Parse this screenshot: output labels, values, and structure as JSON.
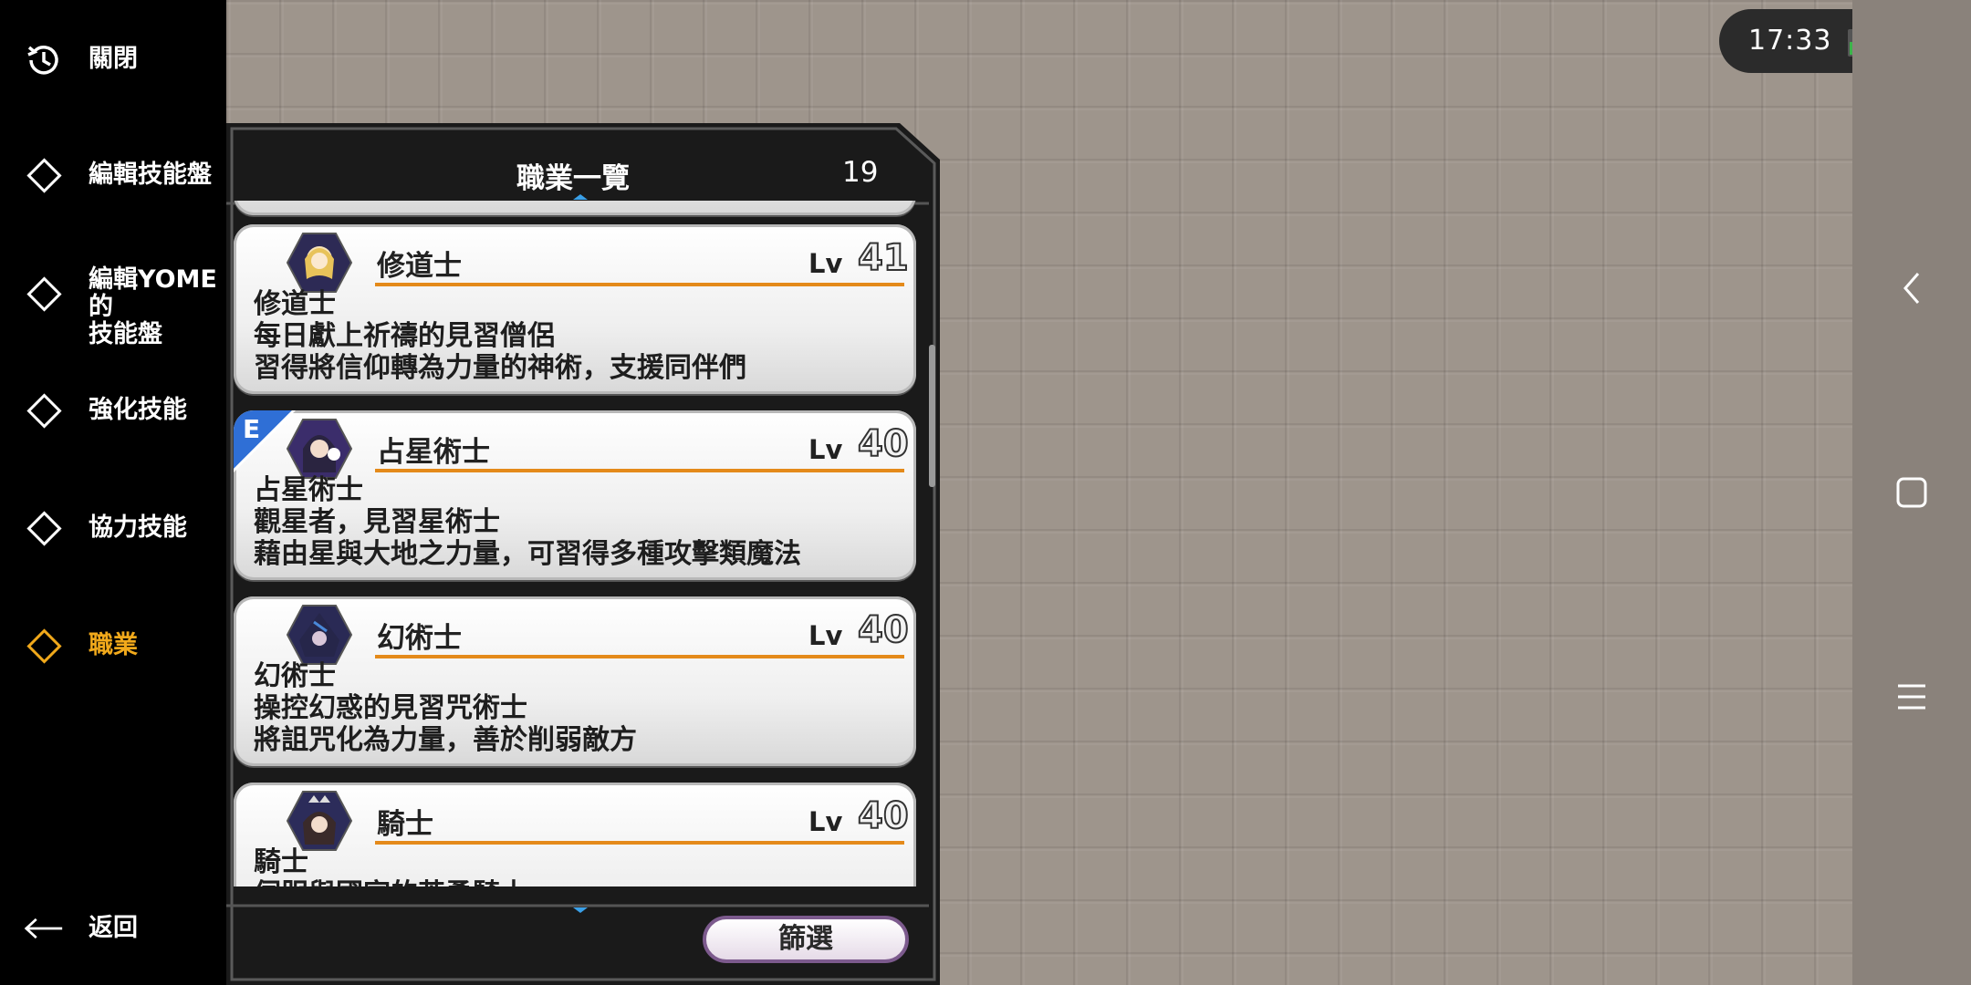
{
  "sidebar": {
    "items": [
      {
        "label": "關閉",
        "icon": "history-icon"
      },
      {
        "label": "編輯技能盤",
        "icon": "diamond-icon"
      },
      {
        "label": "編輯YOME的\n技能盤",
        "icon": "diamond-icon"
      },
      {
        "label": "強化技能",
        "icon": "diamond-icon"
      },
      {
        "label": "協力技能",
        "icon": "diamond-icon"
      },
      {
        "label": "職業",
        "icon": "diamond-icon",
        "active": true
      }
    ],
    "back_label": "返回"
  },
  "status_bar": {
    "time": "17:33"
  },
  "panel": {
    "title": "職業一覽",
    "count": "19",
    "jobs": [
      {
        "name": "修道士",
        "lv_label": "Lv",
        "level": "41",
        "badge": "",
        "desc": [
          "修道士",
          "每日獻上祈禱的見習僧侶",
          "習得將信仰轉為力量的神術，支援同伴們"
        ]
      },
      {
        "name": "占星術士",
        "lv_label": "Lv",
        "level": "40",
        "badge": "E",
        "desc": [
          "占星術士",
          "觀星者，見習星術士",
          "藉由星與大地之力量，可習得多種攻擊類魔法"
        ]
      },
      {
        "name": "幻術士",
        "lv_label": "Lv",
        "level": "40",
        "badge": "",
        "desc": [
          "幻術士",
          "操控幻惑的見習咒術士",
          "將詛咒化為力量，善於削弱敵方"
        ]
      },
      {
        "name": "騎士",
        "lv_label": "Lv",
        "level": "40",
        "badge": "",
        "desc": [
          "騎士",
          "伺服與國家的英勇騎士"
        ]
      }
    ],
    "filter_label": "篩選"
  },
  "colors": {
    "accent": "#f1a91b",
    "level_bar": "#e48a1a",
    "badge_blue": "#2f6fd6"
  }
}
